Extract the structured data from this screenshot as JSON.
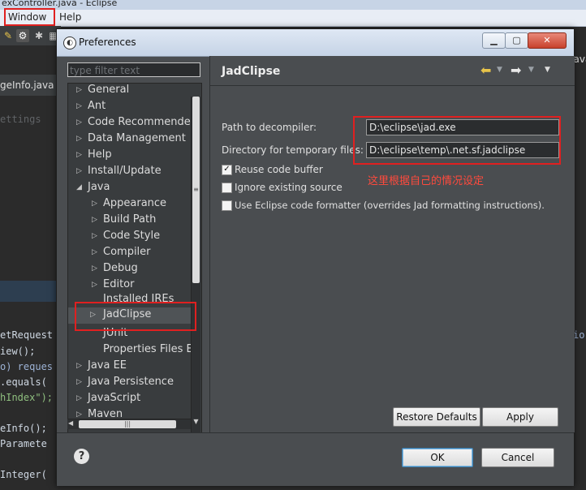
{
  "window": {
    "title": "exController.java - Eclipse"
  },
  "menu": {
    "window": "Window",
    "help": "Help"
  },
  "editor": {
    "tab": "geInfo.java",
    "tab_right": "Java",
    "lines": [
      "ettings",
      "etRequest",
      "iew();",
      "o) reques",
      ".equals(",
      "hIndex\");",
      "eInfo();",
      "Paramete",
      "Integer("
    ],
    "right_fragment": "io"
  },
  "dialog": {
    "title": "Preferences",
    "filter_placeholder": "type filter text",
    "tree": [
      {
        "label": "General",
        "expanded": false,
        "level": 0
      },
      {
        "label": "Ant",
        "expanded": false,
        "level": 0
      },
      {
        "label": "Code Recommenders",
        "expanded": false,
        "level": 0
      },
      {
        "label": "Data Management",
        "expanded": false,
        "level": 0
      },
      {
        "label": "Help",
        "expanded": false,
        "level": 0
      },
      {
        "label": "Install/Update",
        "expanded": false,
        "level": 0
      },
      {
        "label": "Java",
        "expanded": true,
        "level": 0
      },
      {
        "label": "Appearance",
        "expanded": false,
        "level": 1
      },
      {
        "label": "Build Path",
        "expanded": false,
        "level": 1
      },
      {
        "label": "Code Style",
        "expanded": false,
        "level": 1
      },
      {
        "label": "Compiler",
        "expanded": false,
        "level": 1
      },
      {
        "label": "Debug",
        "expanded": false,
        "level": 1
      },
      {
        "label": "Editor",
        "expanded": false,
        "level": 1
      },
      {
        "label": "Installed JREs",
        "expanded": false,
        "level": 1
      },
      {
        "label": "JadClipse",
        "expanded": false,
        "level": 1,
        "selected": true
      },
      {
        "label": "JUnit",
        "level": 1
      },
      {
        "label": "Properties Files Ed",
        "level": 1
      },
      {
        "label": "Java EE",
        "expanded": false,
        "level": 0
      },
      {
        "label": "Java Persistence",
        "expanded": false,
        "level": 0
      },
      {
        "label": "JavaScript",
        "expanded": false,
        "level": 0
      },
      {
        "label": "Maven",
        "expanded": false,
        "level": 0
      }
    ],
    "panel": {
      "title": "JadClipse",
      "path_label": "Path to decompiler:",
      "path_value": "D:\\eclipse\\jad.exe",
      "dir_label": "Directory for temporary files:",
      "dir_value": "D:\\eclipse\\temp\\.net.sf.jadclipse",
      "annotation": "这里根据自己的情况设定",
      "options": [
        {
          "label": "Reuse code buffer",
          "checked": true
        },
        {
          "label": "Ignore existing source",
          "checked": false
        },
        {
          "label": "Use Eclipse code formatter (overrides Jad formatting instructions).",
          "checked": false
        }
      ],
      "restore_defaults": "Restore Defaults",
      "apply": "Apply"
    },
    "ok": "OK",
    "cancel": "Cancel"
  },
  "colors": {
    "annotation_red": "#e02020",
    "dialog_bg": "#4a4d50"
  }
}
